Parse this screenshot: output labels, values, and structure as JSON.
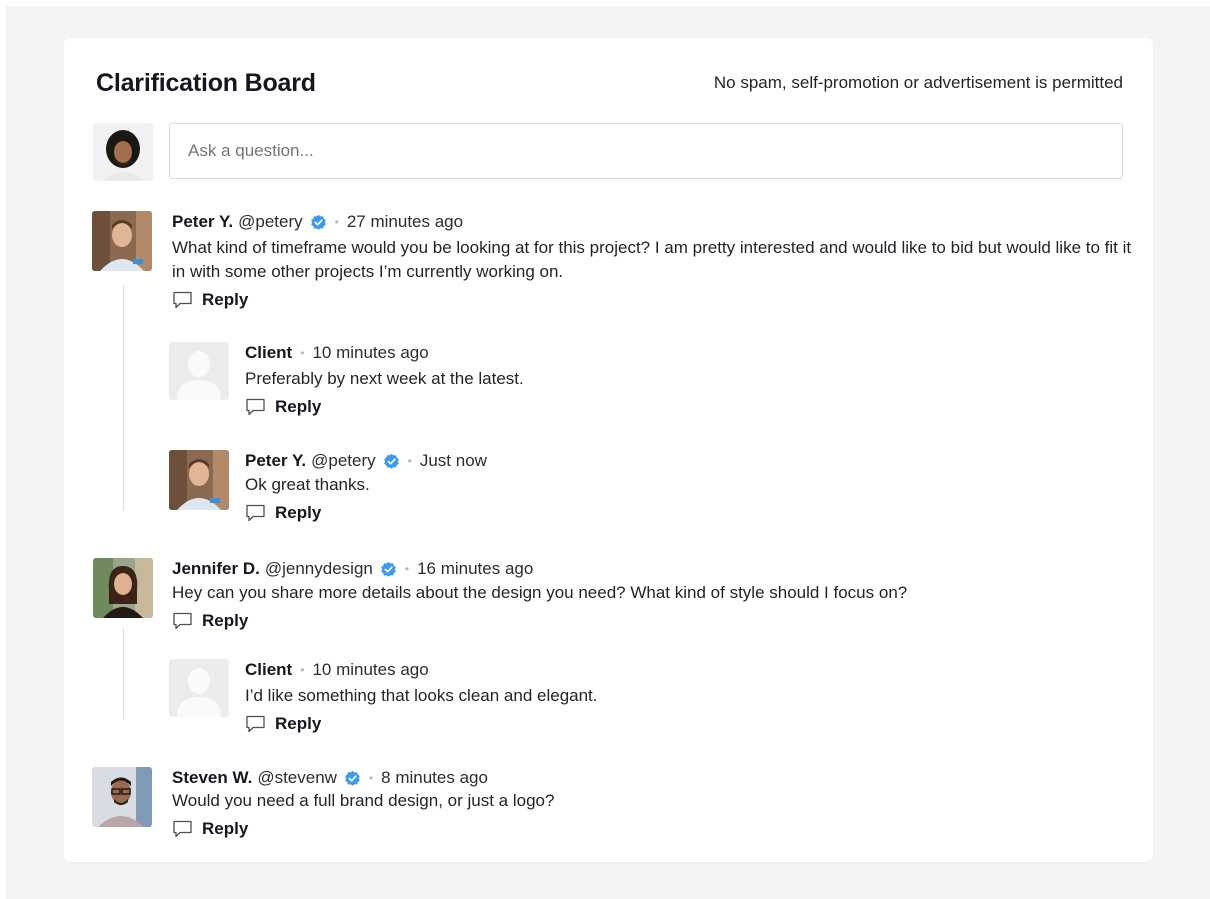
{
  "board": {
    "title": "Clarification Board",
    "rule": "No spam, self-promotion or advertisement is permitted",
    "ask_placeholder": "Ask a question..."
  },
  "comments": [
    {
      "author": "Peter Y.",
      "handle": "@petery",
      "verified": true,
      "time": "27 minutes ago",
      "text": "What kind of timeframe would you be looking at for this project? I am pretty interested and would like to bid but would like to fit it in with some other projects I’m currently working on.",
      "reply_label": "Reply",
      "replies": [
        {
          "author": "Client",
          "time": "10 minutes ago",
          "text": "Preferably by next week at the latest.",
          "reply_label": "Reply"
        },
        {
          "author": "Peter Y.",
          "handle": "@petery",
          "verified": true,
          "time": "Just now",
          "text": "Ok great thanks.",
          "reply_label": "Reply"
        }
      ]
    },
    {
      "author": "Jennifer D.",
      "handle": "@jennydesign",
      "verified": true,
      "time": "16 minutes ago",
      "text": "Hey can you share more details about the design you need? What kind of style should I focus on?",
      "reply_label": "Reply",
      "replies": [
        {
          "author": "Client",
          "time": "10 minutes ago",
          "text": "I’d like something that looks clean and elegant.",
          "reply_label": "Reply"
        }
      ]
    },
    {
      "author": "Steven W.",
      "handle": "@stevenw",
      "verified": true,
      "time": "8 minutes ago",
      "text": "Would you need a full brand design, or just a logo?",
      "reply_label": "Reply",
      "replies": []
    }
  ],
  "colors": {
    "verified": "#3d9be9",
    "page_bg": "#f4f4f4",
    "card_bg": "#ffffff",
    "thread_line": "#dcdde1"
  }
}
